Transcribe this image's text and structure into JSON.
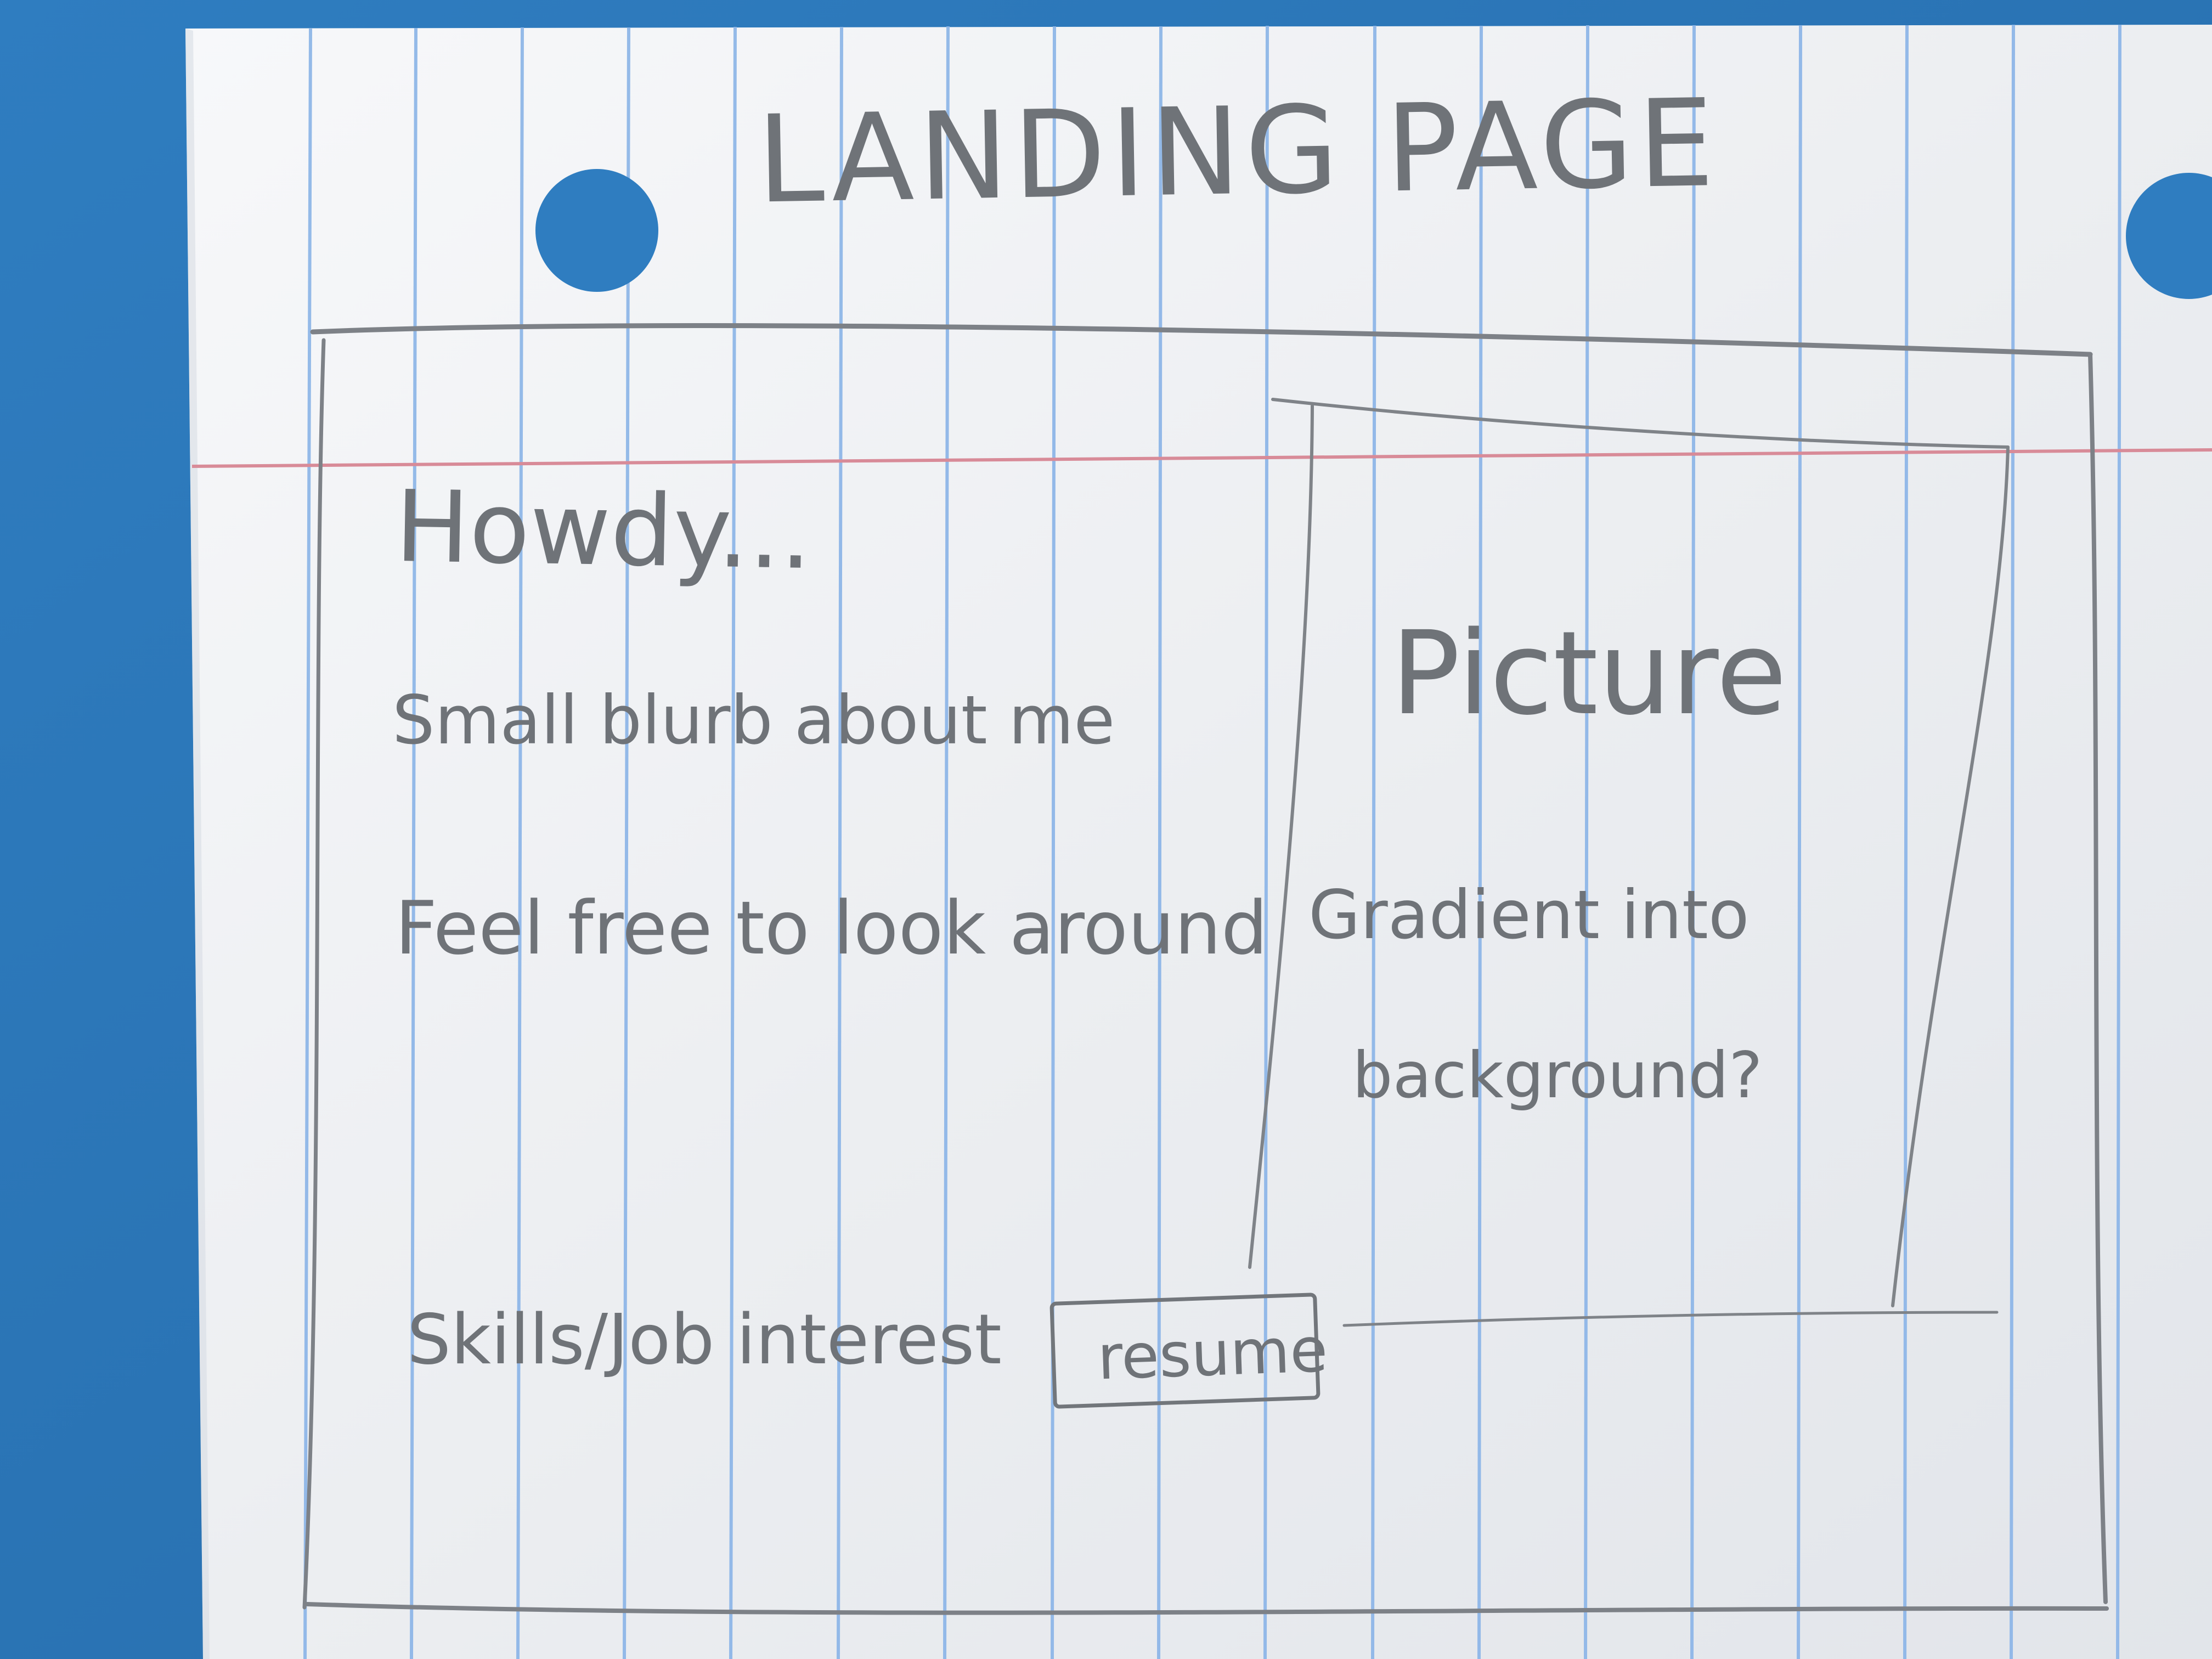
{
  "sketch": {
    "title": "LANDING PAGE",
    "greeting": "Howdy...",
    "blurb": "Small blurb about me",
    "invite": "Feel free to look around",
    "picture_label": "Picture",
    "picture_note_line1": "Gradient into",
    "picture_note_line2": "background?",
    "skills_label": "Skills/Job interest",
    "resume_label": "resume"
  },
  "colors": {
    "desk": "#2f7dc0",
    "paper": "#f2f3f5",
    "ruled_blue": "#8fb7e8",
    "margin_red": "#d88b98",
    "pencil": "#6f7378"
  }
}
